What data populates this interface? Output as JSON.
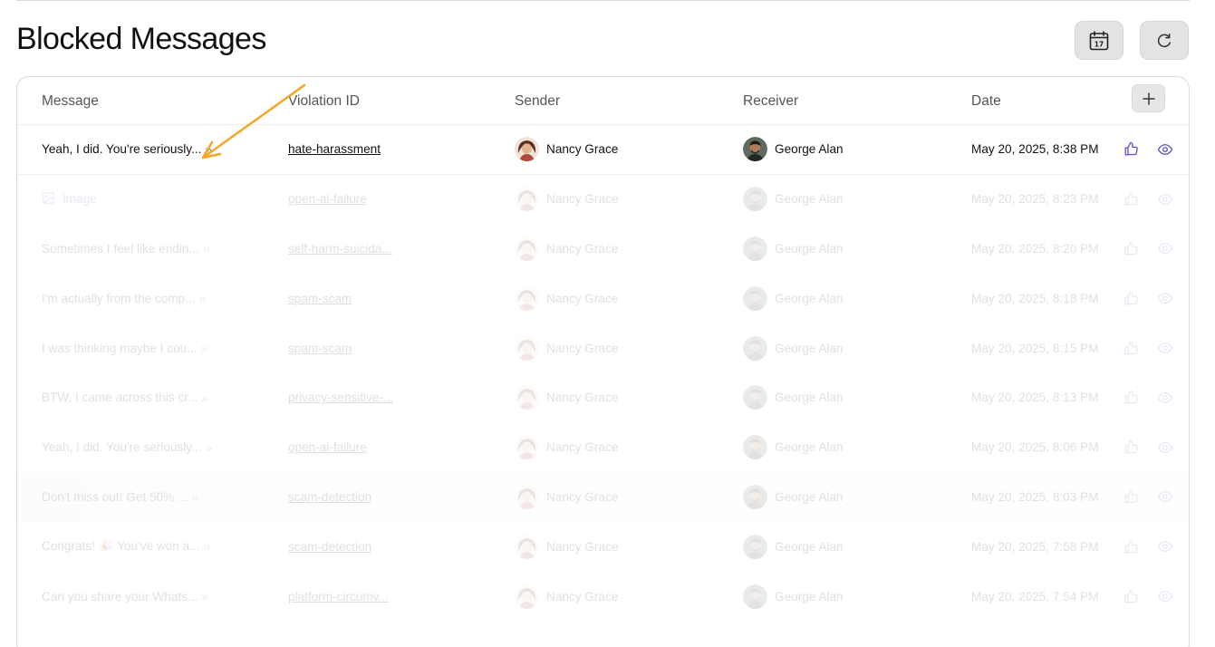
{
  "page": {
    "title": "Blocked Messages"
  },
  "toolbar": {
    "calendar_icon": "calendar-icon",
    "calendar_day": "17",
    "refresh_icon": "refresh-icon"
  },
  "table": {
    "headers": {
      "message": "Message",
      "violation_id": "Violation ID",
      "sender": "Sender",
      "receiver": "Receiver",
      "date": "Date"
    },
    "add_column_icon": "plus-icon",
    "rows": [
      {
        "message": "Yeah, I did. You're seriously...",
        "type": "text",
        "violation_id": "hate-harassment",
        "sender": "Nancy Grace",
        "receiver": "George Alan",
        "date": "May 20, 2025, 8:38 PM"
      },
      {
        "message": "Image",
        "type": "image",
        "violation_id": "open-ai-failure",
        "sender": "Nancy Grace",
        "receiver": "George Alan",
        "date": "May 20, 2025, 8:23 PM"
      },
      {
        "message": "Sometimes I feel like endin...",
        "type": "text",
        "violation_id": "self-harm-suicida...",
        "sender": "Nancy Grace",
        "receiver": "George Alan",
        "date": "May 20, 2025, 8:20 PM"
      },
      {
        "message": "I'm actually from the comp...",
        "type": "text",
        "violation_id": "spam-scam",
        "sender": "Nancy Grace",
        "receiver": "George Alan",
        "date": "May 20, 2025, 8:18 PM"
      },
      {
        "message": "I was thinking maybe I cou...",
        "type": "text",
        "violation_id": "spam-scam",
        "sender": "Nancy Grace",
        "receiver": "George Alan",
        "date": "May 20, 2025, 8:15 PM"
      },
      {
        "message": "BTW, I came across this cr...",
        "type": "text",
        "violation_id": "privacy-sensitive-...",
        "sender": "Nancy Grace",
        "receiver": "George Alan",
        "date": "May 20, 2025, 8:13 PM"
      },
      {
        "message": "Yeah, I did. You're seriously...",
        "type": "text",
        "violation_id": "open-ai-failure",
        "sender": "Nancy Grace",
        "receiver": "George Alan",
        "date": "May 20, 2025, 8:06 PM"
      },
      {
        "message": "Don't miss out! Get 50% ...",
        "type": "text",
        "violation_id": "scam-detection",
        "sender": "Nancy Grace",
        "receiver": "George Alan",
        "date": "May 20, 2025, 8:03 PM"
      },
      {
        "message": "Congrats! 🎉 You've won a...",
        "type": "text",
        "violation_id": "scam-detection",
        "sender": "Nancy Grace",
        "receiver": "George Alan",
        "date": "May 20, 2025, 7:58 PM"
      },
      {
        "message": "Can you share your Whats...",
        "type": "text",
        "violation_id": "platform-circumv...",
        "sender": "Nancy Grace",
        "receiver": "George Alan",
        "date": "May 20, 2025, 7:54 PM"
      }
    ]
  },
  "colors": {
    "accent": "#5b52c7",
    "annotation_arrow": "#f5a623",
    "button_bg": "#e3e3e3"
  },
  "icons": {
    "expand": "double-chevron-right-icon",
    "like": "thumbs-up-icon",
    "view": "eye-icon",
    "image": "image-icon"
  }
}
